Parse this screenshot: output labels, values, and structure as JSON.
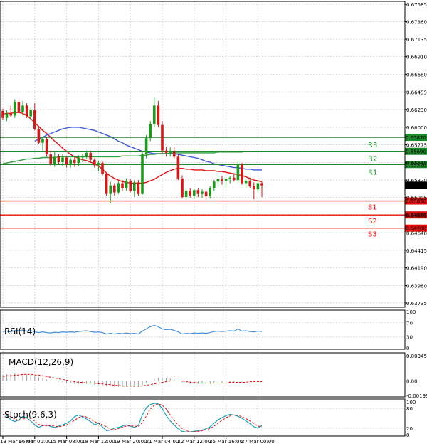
{
  "colors": {
    "bull": "#1a9b1a",
    "bear": "#d11a1a",
    "ma_fast": "#e01010",
    "ma_slow": "#3d5ad6",
    "ma_mid": "#2e9e3a",
    "resistance": "#1b8a2a",
    "support": "#e01010",
    "rsi": "#4a90d9",
    "macd_hist": "#9a9a9a",
    "macd_signal": "#e01010",
    "stoch_main": "#18a0b8",
    "stoch_signal": "#e01010",
    "grid": "#d6d6d6"
  },
  "chart_data": [
    {
      "type": "candlestick",
      "panel": "price",
      "y_ticks": [
        "0.67585",
        "0.67360",
        "0.67135",
        "0.66910",
        "0.66680",
        "0.66455",
        "0.66230",
        "0.66000",
        "0.65775",
        "0.65545",
        "0.65320",
        "0.65095",
        "0.64865",
        "0.64640",
        "0.64415",
        "0.64190",
        "0.63960",
        "0.63735"
      ],
      "ylim": [
        0.63735,
        0.67585
      ],
      "x_ticks": [
        "13 Mar 16:00",
        "14 Mar 00:00",
        "15 Mar 08:00",
        "18 Mar 12:00",
        "19 Mar 20:00",
        "21 Mar 04:00",
        "22 Mar 12:00",
        "25 Mar 16:00",
        "27 Mar 00:00"
      ],
      "current_price": "0.65253",
      "candles": [
        [
          0.6621,
          0.6624,
          0.661,
          0.6612
        ],
        [
          0.6612,
          0.6622,
          0.6608,
          0.6618
        ],
        [
          0.6618,
          0.6628,
          0.6613,
          0.6615
        ],
        [
          0.6615,
          0.6636,
          0.6612,
          0.6632
        ],
        [
          0.6632,
          0.6636,
          0.6618,
          0.662
        ],
        [
          0.662,
          0.6634,
          0.6615,
          0.6628
        ],
        [
          0.6628,
          0.6631,
          0.6612,
          0.6614
        ],
        [
          0.6614,
          0.6625,
          0.661,
          0.6622
        ],
        [
          0.6622,
          0.6631,
          0.6596,
          0.6598
        ],
        [
          0.6598,
          0.6602,
          0.6578,
          0.658
        ],
        [
          0.658,
          0.6588,
          0.657,
          0.6585
        ],
        [
          0.6585,
          0.6587,
          0.6562,
          0.6565
        ],
        [
          0.6565,
          0.657,
          0.655,
          0.6553
        ],
        [
          0.6553,
          0.6568,
          0.6549,
          0.6562
        ],
        [
          0.6562,
          0.6566,
          0.6552,
          0.6555
        ],
        [
          0.6555,
          0.6566,
          0.655,
          0.6561
        ],
        [
          0.6561,
          0.6562,
          0.6548,
          0.6552
        ],
        [
          0.6552,
          0.656,
          0.6548,
          0.6558
        ],
        [
          0.6558,
          0.6562,
          0.6549,
          0.6554
        ],
        [
          0.6554,
          0.6564,
          0.655,
          0.6561
        ],
        [
          0.6561,
          0.6566,
          0.6555,
          0.6563
        ],
        [
          0.6563,
          0.657,
          0.656,
          0.6567
        ],
        [
          0.6567,
          0.657,
          0.6555,
          0.6558
        ],
        [
          0.6558,
          0.656,
          0.6548,
          0.6551
        ],
        [
          0.6551,
          0.6557,
          0.6544,
          0.6554
        ],
        [
          0.6554,
          0.6556,
          0.6538,
          0.654
        ],
        [
          0.654,
          0.6542,
          0.6512,
          0.6514
        ],
        [
          0.6514,
          0.653,
          0.6502,
          0.6525
        ],
        [
          0.6525,
          0.6528,
          0.6512,
          0.6516
        ],
        [
          0.6516,
          0.6531,
          0.6514,
          0.6528
        ],
        [
          0.6528,
          0.6532,
          0.6518,
          0.6522
        ],
        [
          0.6522,
          0.6534,
          0.6518,
          0.6531
        ],
        [
          0.6531,
          0.6533,
          0.6516,
          0.6518
        ],
        [
          0.6518,
          0.6532,
          0.651,
          0.6529
        ],
        [
          0.6529,
          0.6532,
          0.6512,
          0.6514
        ],
        [
          0.6514,
          0.6568,
          0.6513,
          0.6565
        ],
        [
          0.6565,
          0.659,
          0.656,
          0.6586
        ],
        [
          0.6586,
          0.6608,
          0.6582,
          0.6604
        ],
        [
          0.6604,
          0.6638,
          0.66,
          0.6628
        ],
        [
          0.6628,
          0.6634,
          0.66,
          0.6603
        ],
        [
          0.6603,
          0.6608,
          0.6566,
          0.657
        ],
        [
          0.657,
          0.6575,
          0.6562,
          0.6567
        ],
        [
          0.6567,
          0.6574,
          0.6562,
          0.6569
        ],
        [
          0.6569,
          0.6575,
          0.656,
          0.6562
        ],
        [
          0.6562,
          0.6565,
          0.6532,
          0.6534
        ],
        [
          0.6534,
          0.6538,
          0.6508,
          0.651
        ],
        [
          0.651,
          0.6522,
          0.6507,
          0.6518
        ],
        [
          0.6518,
          0.6522,
          0.6509,
          0.6512
        ],
        [
          0.6512,
          0.6521,
          0.6508,
          0.6519
        ],
        [
          0.6519,
          0.6522,
          0.651,
          0.6514
        ],
        [
          0.6514,
          0.652,
          0.6509,
          0.6517
        ],
        [
          0.6517,
          0.652,
          0.6507,
          0.6511
        ],
        [
          0.6511,
          0.6524,
          0.6508,
          0.6522
        ],
        [
          0.6522,
          0.6532,
          0.6518,
          0.653
        ],
        [
          0.653,
          0.6536,
          0.6524,
          0.6533
        ],
        [
          0.6533,
          0.6537,
          0.6526,
          0.6531
        ],
        [
          0.6531,
          0.6535,
          0.6522,
          0.6533
        ],
        [
          0.6533,
          0.6537,
          0.6528,
          0.6535
        ],
        [
          0.6535,
          0.6541,
          0.653,
          0.6532
        ],
        [
          0.6532,
          0.6557,
          0.6529,
          0.6552
        ],
        [
          0.6552,
          0.6554,
          0.6526,
          0.6528
        ],
        [
          0.6528,
          0.6534,
          0.6522,
          0.6531
        ],
        [
          0.6531,
          0.6535,
          0.6522,
          0.6524
        ],
        [
          0.6524,
          0.6529,
          0.6507,
          0.652
        ],
        [
          0.652,
          0.6532,
          0.6516,
          0.6528
        ],
        [
          0.6528,
          0.653,
          0.651,
          0.6525
        ]
      ],
      "moving_averages": [
        {
          "color_key": "ma_fast",
          "values": [
            0.6617,
            0.6618,
            0.6618,
            0.6619,
            0.6619,
            0.6618,
            0.6615,
            0.6611,
            0.6606,
            0.6601,
            0.6596,
            0.6592,
            0.6587,
            0.6582,
            0.6578,
            0.6573,
            0.6569,
            0.6565,
            0.6562,
            0.656,
            0.6558,
            0.6557,
            0.6555,
            0.6553,
            0.655,
            0.6546,
            0.6541,
            0.6537,
            0.6534,
            0.6532,
            0.653,
            0.6529,
            0.6528,
            0.6528,
            0.6528,
            0.6528,
            0.6529,
            0.6531,
            0.6533,
            0.6536,
            0.6539,
            0.6542,
            0.6544,
            0.6546,
            0.6547,
            0.6547,
            0.6546,
            0.6546,
            0.6545,
            0.6545,
            0.6545,
            0.6544,
            0.6544,
            0.6544,
            0.6543,
            0.6543,
            0.6542,
            0.6541,
            0.654,
            0.6539,
            0.6538,
            0.6536,
            0.6534,
            0.6532,
            0.6531,
            0.653
          ]
        },
        {
          "color_key": "ma_slow",
          "values": [
            null,
            null,
            null,
            null,
            null,
            null,
            null,
            null,
            0.6582,
            0.6585,
            0.6587,
            0.659,
            0.6592,
            0.6594,
            0.6596,
            0.6598,
            0.6599,
            0.66,
            0.66,
            0.66,
            0.6599,
            0.6598,
            0.6597,
            0.6596,
            0.6594,
            0.6592,
            0.659,
            0.6588,
            0.6585,
            0.6582,
            0.658,
            0.6577,
            0.6575,
            0.6573,
            0.6571,
            0.6569,
            0.6568,
            0.6567,
            0.6566,
            0.6566,
            0.6566,
            0.6566,
            0.6566,
            0.6566,
            0.6565,
            0.6564,
            0.6563,
            0.6562,
            0.6561,
            0.656,
            0.6558,
            0.6556,
            0.6555,
            0.6553,
            0.6552,
            0.6551,
            0.655,
            0.6549,
            0.6548,
            0.6548,
            0.6547,
            0.6546,
            0.6546,
            0.6545,
            0.6545,
            0.6545
          ]
        },
        {
          "color_key": "ma_mid",
          "values": [
            0.6553,
            0.6554,
            0.6555,
            0.6556,
            0.6557,
            0.6558,
            0.6559,
            0.6559,
            0.656,
            0.656,
            0.6561,
            0.6561,
            0.6561,
            0.6561,
            0.6562,
            0.6562,
            0.6562,
            0.6562,
            0.6562,
            0.6562,
            0.6562,
            0.6562,
            0.6562,
            0.6562,
            0.6562,
            0.6562,
            0.6562,
            0.6562,
            0.6562,
            0.6562,
            0.6563,
            0.6563,
            0.6563,
            0.6563,
            0.6563,
            0.6564,
            0.6564,
            0.6565,
            0.6565,
            0.6566,
            0.6566,
            0.6566,
            0.6567,
            0.6567,
            0.6567,
            0.6567,
            0.6567,
            0.6567,
            0.6567,
            0.6567,
            0.6567,
            0.6567,
            0.6567,
            0.6567,
            0.6568,
            0.6568,
            0.6568,
            0.6568,
            0.6568,
            0.6568,
            0.6568,
            0.6569,
            0.6569,
            0.6569,
            0.6569,
            0.6569
          ]
        }
      ],
      "levels": [
        {
          "name": "R3",
          "value": 0.6587,
          "label": "0.65870",
          "kind": "resistance"
        },
        {
          "name": "R2",
          "value": 0.6569,
          "label": "0.65690",
          "kind": "resistance"
        },
        {
          "name": "R1",
          "value": 0.6552,
          "label": "0.65520",
          "kind": "resistance"
        },
        {
          "name": "S1",
          "value": 0.6505,
          "label": "0.65050",
          "kind": "support"
        },
        {
          "name": "S2",
          "value": 0.6487,
          "label": "0.64870",
          "kind": "support"
        },
        {
          "name": "S3",
          "value": 0.647,
          "label": "0.64700",
          "kind": "support"
        }
      ]
    },
    {
      "type": "line",
      "panel": "rsi",
      "title": "RSI(14)",
      "ylim": [
        0,
        100
      ],
      "y_ticks": [
        "100",
        "70",
        "30",
        "0"
      ],
      "levels": [
        70,
        30
      ],
      "values": [
        45,
        46,
        44,
        48,
        47,
        49,
        46,
        47,
        44,
        42,
        44,
        42,
        41,
        43,
        42,
        44,
        43,
        44,
        43,
        45,
        46,
        47,
        45,
        43,
        44,
        42,
        38,
        40,
        38,
        40,
        39,
        41,
        39,
        40,
        38,
        46,
        52,
        58,
        62,
        58,
        52,
        50,
        51,
        48,
        44,
        38,
        40,
        39,
        41,
        40,
        41,
        40,
        42,
        45,
        46,
        45,
        46,
        47,
        46,
        52,
        46,
        47,
        45,
        44,
        46,
        45
      ]
    },
    {
      "type": "bar",
      "panel": "macd",
      "title": "MACD(12,26,9)",
      "ylim": [
        -0.001999,
        0.003453
      ],
      "y_ticks": [
        "0.003453",
        "0.00",
        "-0.001999"
      ],
      "histogram": [
        0.0008,
        0.0009,
        0.0009,
        0.001,
        0.001,
        0.001,
        0.0009,
        0.0008,
        0.0007,
        0.0005,
        0.0004,
        0.0002,
        0.0001,
        -0.0,
        -0.0001,
        -0.0002,
        -0.0003,
        -0.0003,
        -0.0004,
        -0.0004,
        -0.0004,
        -0.0004,
        -0.0004,
        -0.0005,
        -0.0005,
        -0.0006,
        -0.0007,
        -0.0007,
        -0.0008,
        -0.0008,
        -0.0008,
        -0.0008,
        -0.0008,
        -0.0008,
        -0.0008,
        -0.0006,
        -0.0003,
        0.0,
        0.0003,
        0.0004,
        0.0004,
        0.0004,
        0.0003,
        0.0002,
        0.0,
        -0.0002,
        -0.0003,
        -0.0004,
        -0.0004,
        -0.0004,
        -0.0004,
        -0.0004,
        -0.0004,
        -0.0003,
        -0.0003,
        -0.0003,
        -0.0002,
        -0.0002,
        -0.0002,
        -0.0001,
        -0.0001,
        -0.0001,
        -0.0001,
        -0.0001,
        -0.0001,
        -0.0001
      ],
      "signal": [
        0.0006,
        0.0007,
        0.0007,
        0.0008,
        0.0008,
        0.0009,
        0.0009,
        0.0009,
        0.0008,
        0.0008,
        0.0007,
        0.0006,
        0.0005,
        0.0004,
        0.0003,
        0.0002,
        0.0001,
        0.0,
        -0.0001,
        -0.0002,
        -0.0002,
        -0.0003,
        -0.0003,
        -0.0003,
        -0.0004,
        -0.0004,
        -0.0005,
        -0.0005,
        -0.0006,
        -0.0006,
        -0.0007,
        -0.0007,
        -0.0007,
        -0.0007,
        -0.0007,
        -0.0007,
        -0.0006,
        -0.0005,
        -0.0004,
        -0.0003,
        -0.0002,
        -0.0001,
        -0.0,
        0.0,
        0.0,
        -0.0,
        -0.0001,
        -0.0002,
        -0.0002,
        -0.0003,
        -0.0003,
        -0.0003,
        -0.0003,
        -0.0003,
        -0.0003,
        -0.0003,
        -0.0003,
        -0.0002,
        -0.0002,
        -0.0002,
        -0.0002,
        -0.0002,
        -0.0001,
        -0.0001,
        -0.0001,
        -0.0001
      ]
    },
    {
      "type": "line",
      "panel": "stochastic",
      "title": "Stoch(9,6,3)",
      "ylim": [
        0,
        100
      ],
      "y_ticks": [
        "100",
        "80",
        "20",
        "0"
      ],
      "levels": [
        80,
        20
      ],
      "main": [
        62,
        58,
        45,
        40,
        45,
        55,
        52,
        42,
        30,
        22,
        28,
        30,
        25,
        22,
        26,
        30,
        35,
        42,
        55,
        60,
        54,
        48,
        40,
        30,
        35,
        24,
        12,
        14,
        20,
        22,
        26,
        30,
        26,
        22,
        28,
        60,
        82,
        92,
        96,
        94,
        80,
        58,
        42,
        30,
        18,
        10,
        8,
        8,
        10,
        12,
        14,
        18,
        24,
        35,
        45,
        52,
        58,
        62,
        60,
        56,
        50,
        42,
        34,
        24,
        20,
        28
      ],
      "signal": [
        60,
        60,
        54,
        48,
        43,
        47,
        51,
        50,
        41,
        31,
        27,
        27,
        28,
        26,
        24,
        26,
        30,
        36,
        44,
        52,
        56,
        54,
        48,
        40,
        35,
        30,
        24,
        17,
        15,
        19,
        23,
        26,
        27,
        26,
        25,
        37,
        57,
        78,
        90,
        94,
        90,
        78,
        60,
        43,
        30,
        19,
        12,
        9,
        9,
        10,
        12,
        15,
        19,
        26,
        35,
        44,
        52,
        57,
        60,
        59,
        55,
        49,
        42,
        33,
        26,
        24
      ]
    }
  ]
}
